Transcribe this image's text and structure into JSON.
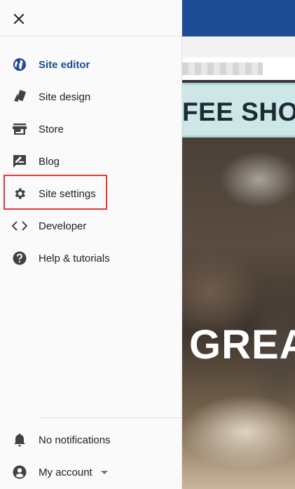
{
  "drawer": {
    "close_icon": "close-icon",
    "nav_items": [
      {
        "label": "Site editor",
        "icon": "globe-icon",
        "active": true
      },
      {
        "label": "Site design",
        "icon": "design-icon",
        "active": false
      },
      {
        "label": "Store",
        "icon": "store-icon",
        "active": false
      },
      {
        "label": "Blog",
        "icon": "blog-icon",
        "active": false
      },
      {
        "label": "Site settings",
        "icon": "gear-icon",
        "active": false
      },
      {
        "label": "Developer",
        "icon": "code-icon",
        "active": false
      },
      {
        "label": "Help & tutorials",
        "icon": "help-icon",
        "active": false
      }
    ],
    "footer_items": [
      {
        "label": "No notifications",
        "icon": "bell-icon"
      },
      {
        "label": "My account",
        "icon": "account-icon"
      }
    ]
  },
  "preview": {
    "banner_text": "FEE SHOP",
    "hero_text": "GREAT"
  },
  "colors": {
    "accent": "#1d4b94",
    "highlight": "#e53935"
  }
}
